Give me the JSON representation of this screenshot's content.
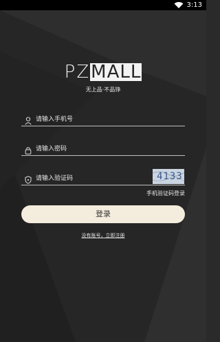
{
  "statusbar": {
    "time": "3:13",
    "wifi_icon": "wifi-icon"
  },
  "brand": {
    "logo_pz": "PZ",
    "logo_mall": "MALL",
    "slogan": "无上品·不品铮"
  },
  "form": {
    "phone_placeholder": "请输入手机号",
    "password_placeholder": "请输入密码",
    "captcha_placeholder": "请输入验证码",
    "captcha_code": "4133",
    "sms_login": "手机验证码登录",
    "login_button": "登录",
    "register_link": "没有账号，立即注册"
  },
  "icons": {
    "phone": "user-icon",
    "password": "lock-icon",
    "captcha": "shield-icon"
  },
  "colors": {
    "background": "#262626",
    "button": "#f4ecdd",
    "underline": "#bfbfbf"
  }
}
